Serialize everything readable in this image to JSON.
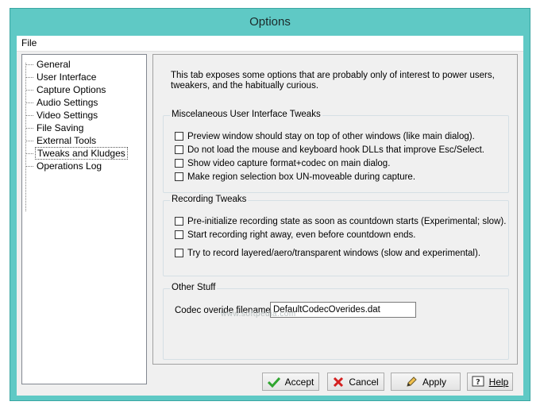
{
  "window": {
    "title": "Options"
  },
  "menu": {
    "file": "File"
  },
  "tree": {
    "items": [
      "General",
      "User Interface",
      "Capture Options",
      "Audio Settings",
      "Video Settings",
      "File Saving",
      "External Tools",
      "Tweaks and Kludges",
      "Operations Log"
    ],
    "selected": "Tweaks and Kludges"
  },
  "panel": {
    "intro": "This tab exposes some options that are probably only of interest to power users, tweakers, and the habitually curious.",
    "misc": {
      "title": "Miscelaneous User Interface Tweaks",
      "options": [
        "Preview window should stay on top of other windows (like main dialog).",
        "Do not load the mouse and keyboard hook DLLs that improve Esc/Select.",
        "Show video capture format+codec on main dialog.",
        "Make region selection box UN-moveable during capture."
      ]
    },
    "recording": {
      "title": "Recording Tweaks",
      "options": [
        "Pre-initialize recording state as soon as countdown starts (Experimental; slow).",
        "Start recording right away, even before countdown ends.",
        "Try to record layered/aero/transparent windows (slow and experimental)."
      ]
    },
    "other": {
      "title": "Other Stuff",
      "codec_label": "Codec overide filename:",
      "codec_value": "DefaultCodecOverides.dat"
    }
  },
  "buttons": {
    "accept": "Accept",
    "cancel": "Cancel",
    "apply": "Apply",
    "help": "Help"
  },
  "watermark": "www.softpedia.com"
}
